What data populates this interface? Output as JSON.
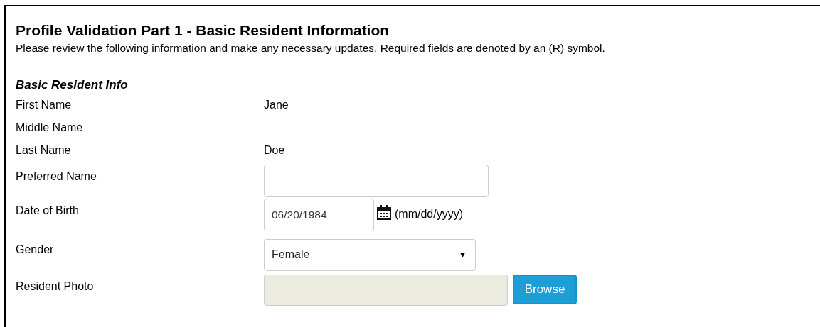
{
  "title": "Profile Validation Part 1 - Basic Resident Information",
  "description": "Please review the following information and make any necessary updates. Required fields are denoted by an (R) symbol.",
  "section": "Basic Resident Info",
  "fields": [
    {
      "kind": "text",
      "label": "First Name",
      "value": "Jane"
    },
    {
      "kind": "text",
      "label": "Middle Name"
    },
    {
      "kind": "text",
      "label": "Last Name",
      "value": "Doe"
    },
    {
      "kind": "input",
      "label": "Preferred Name"
    },
    {
      "kind": "date",
      "label": "Date of Birth",
      "value": "06/20/1984",
      "hint": "(mm/dd/yyyy)"
    },
    {
      "kind": "select",
      "label": "Gender",
      "value": "Female",
      "arrow": "▼"
    },
    {
      "kind": "file",
      "label": "Resident Photo",
      "button": "Browse"
    }
  ]
}
